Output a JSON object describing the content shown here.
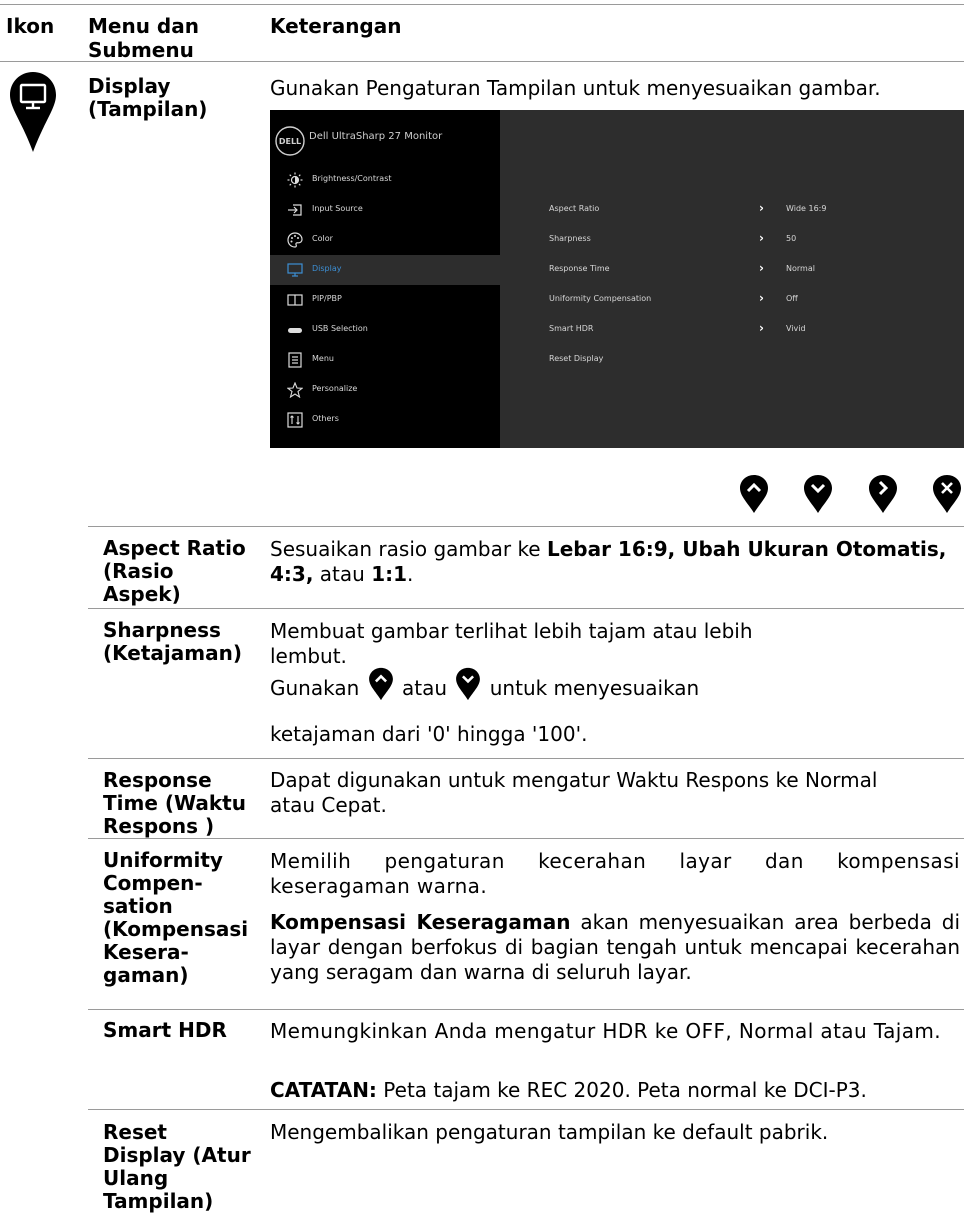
{
  "header": {
    "col_icon": "Ikon",
    "col_menu": "Menu dan Submenu",
    "col_desc": "Keterangan"
  },
  "display_menu": {
    "title": "Display (Tampilan)",
    "description": "Gunakan Pengaturan Tampilan untuk menyesuaikan gambar.",
    "icon": "monitor-icon"
  },
  "osd": {
    "brand_logo": "DELL",
    "brand_title": "Dell UltraSharp 27 Monitor",
    "menu_items": [
      {
        "label": "Brightness/Contrast",
        "icon": "brightness-icon"
      },
      {
        "label": "Input Source",
        "icon": "input-source-icon"
      },
      {
        "label": "Color",
        "icon": "color-palette-icon"
      },
      {
        "label": "Display",
        "icon": "monitor-icon",
        "selected": true
      },
      {
        "label": "PIP/PBP",
        "icon": "pip-icon"
      },
      {
        "label": "USB Selection",
        "icon": "usb-icon"
      },
      {
        "label": "Menu",
        "icon": "menu-icon"
      },
      {
        "label": "Personalize",
        "icon": "star-icon"
      },
      {
        "label": "Others",
        "icon": "others-icon"
      }
    ],
    "settings": [
      {
        "label": "Aspect Ratio",
        "value": "Wide 16:9"
      },
      {
        "label": "Sharpness",
        "value": "50"
      },
      {
        "label": "Response Time",
        "value": "Normal"
      },
      {
        "label": "Uniformity Compensation",
        "value": "Off"
      },
      {
        "label": "Smart HDR",
        "value": "Vivid"
      },
      {
        "label": "Reset Display",
        "value": ""
      }
    ],
    "nav_buttons": [
      "up-icon",
      "down-icon",
      "right-icon",
      "close-icon"
    ]
  },
  "rows": {
    "aspect": {
      "label": "Aspect Ratio (Rasio Aspek)",
      "text_pre": "Sesuaikan rasio gambar ke ",
      "text_bold1": "Lebar 16:9, Ubah Ukuran Otomatis, 4:3,",
      "text_mid": " atau ",
      "text_bold2": "1:1",
      "text_end": "."
    },
    "sharpness": {
      "label": "Sharpness (Ketajaman)",
      "line1": "Membuat gambar terlihat lebih tajam atau lebih",
      "line2": "lembut.",
      "line3_pre": "Gunakan",
      "line3_mid": "atau",
      "line3_post": "untuk menyesuaikan",
      "line4": "ketajaman dari '0' hingga '100'."
    },
    "response": {
      "label": "Response Time (Waktu Respons )",
      "text": "Dapat digunakan untuk mengatur Waktu Respons ke Normal atau Cepat."
    },
    "uniformity": {
      "label": "Uniformity Compen-sation (Kompensasi Kesera-gaman)",
      "para1": "Memilih pengaturan kecerahan layar dan kompensasi keseragaman warna.",
      "para2_bold": "Kompensasi Keseragaman",
      "para2_rest": " akan menyesuaikan area berbeda di layar dengan berfokus di bagian tengah untuk mencapai kecerahan yang seragam dan warna di seluruh layar."
    },
    "smarthdr": {
      "label": "Smart HDR",
      "para1": "Memungkinkan Anda mengatur HDR ke OFF, Normal atau Tajam.",
      "note_bold": "CATATAN:",
      "note_rest": " Peta tajam ke REC 2020.  Peta normal ke DCI-P3."
    },
    "reset": {
      "label": "Reset Display (Atur Ulang Tampilan)",
      "text": "Mengembalikan pengaturan tampilan ke default pabrik."
    }
  }
}
